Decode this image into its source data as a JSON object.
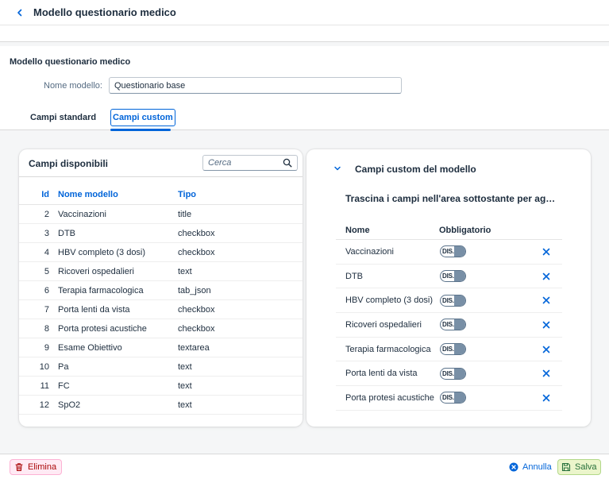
{
  "header": {
    "title": "Modello questionario medico"
  },
  "form": {
    "section_title": "Modello questionario medico",
    "name_label": "Nome modello:",
    "name_value": "Questionario base"
  },
  "tabs": [
    {
      "label": "Campi standard"
    },
    {
      "label": "Campi custom",
      "selected": true
    }
  ],
  "available": {
    "title": "Campi disponibili",
    "search_placeholder": "Cerca",
    "columns": {
      "id": "Id",
      "name": "Nome modello",
      "type": "Tipo"
    },
    "rows": [
      {
        "id": "2",
        "name": "Vaccinazioni",
        "type": "title"
      },
      {
        "id": "3",
        "name": "DTB",
        "type": "checkbox"
      },
      {
        "id": "4",
        "name": "HBV completo (3 dosi)",
        "type": "checkbox"
      },
      {
        "id": "5",
        "name": "Ricoveri ospedalieri",
        "type": "text"
      },
      {
        "id": "6",
        "name": "Terapia farmacologica",
        "type": "tab_json"
      },
      {
        "id": "7",
        "name": "Porta lenti da vista",
        "type": "checkbox"
      },
      {
        "id": "8",
        "name": "Porta protesi acustiche",
        "type": "checkbox"
      },
      {
        "id": "9",
        "name": "Esame Obiettivo",
        "type": "textarea"
      },
      {
        "id": "10",
        "name": "Pa",
        "type": "text"
      },
      {
        "id": "11",
        "name": "FC",
        "type": "text"
      },
      {
        "id": "12",
        "name": "SpO2",
        "type": "text"
      }
    ]
  },
  "custom": {
    "title": "Campi custom del modello",
    "hint": "Trascina i campi nell'area sottostante per aggiungerli",
    "columns": {
      "name": "Nome",
      "required": "Obbligatorio"
    },
    "toggle_off_label": "DIS.",
    "rows": [
      {
        "name": "Vaccinazioni",
        "required": false
      },
      {
        "name": "DTB",
        "required": false
      },
      {
        "name": "HBV completo (3 dosi)",
        "required": false
      },
      {
        "name": "Ricoveri ospedalieri",
        "required": false
      },
      {
        "name": "Terapia farmacologica",
        "required": false
      },
      {
        "name": "Porta lenti da vista",
        "required": false
      },
      {
        "name": "Porta protesi acustiche",
        "required": false
      }
    ]
  },
  "footer": {
    "delete_label": "Elimina",
    "cancel_label": "Annulla",
    "save_label": "Salva"
  },
  "colors": {
    "accent": "#0064d9",
    "delete": "#aa0808",
    "save": "#256f3a"
  }
}
